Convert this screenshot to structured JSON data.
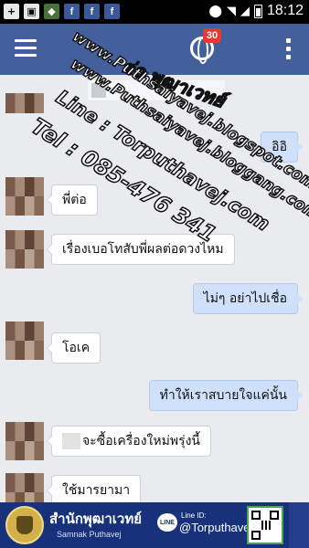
{
  "status_bar": {
    "left_icons": [
      "plus-icon",
      "image-icon",
      "picture-icon",
      "facebook-icon",
      "facebook-icon",
      "facebook-icon"
    ],
    "time": "18:12"
  },
  "app_bar": {
    "notification_count": "30",
    "color": "#44609c"
  },
  "messages": [
    {
      "side": "out",
      "text": "อิอิ"
    },
    {
      "side": "in",
      "text": "พี่ต่อ"
    },
    {
      "side": "in",
      "text": "เรื่องเบอโทสับพี่ผลต่อดวงไหม"
    },
    {
      "side": "out",
      "text": "ไม่ๆ อย่าไปเชื่อ"
    },
    {
      "side": "in",
      "text": "โอเค"
    },
    {
      "side": "out",
      "text": "ทำให้เราสบายใจแค่นั้น"
    },
    {
      "side": "in",
      "text": "จะซื้อเครื่องใหม่พรุ่งนี้"
    },
    {
      "side": "in",
      "text": "ใช้มารยามา"
    }
  ],
  "watermark": {
    "line1": "ต่อ พุฒาเวทย์",
    "line2": "www.Puthsaiyavej.blogspot.com",
    "line3": "www.Puthsaiyavej.bloggang.com",
    "line4": "Line : Torputhavej.com",
    "line5": "Tel : 085-476 341"
  },
  "banner": {
    "name": "สำนักพุฒาเวทย์",
    "subtitle": "Samnak Puthavej",
    "line_badge": "LINE",
    "line_id_label": "Line ID:",
    "line_id": "@Torputhavej"
  },
  "colors": {
    "incoming_bubble": "#ffffff",
    "outgoing_bubble": "#cfe0fa",
    "chat_background": "#e9ebef",
    "banner": "#17327a"
  }
}
